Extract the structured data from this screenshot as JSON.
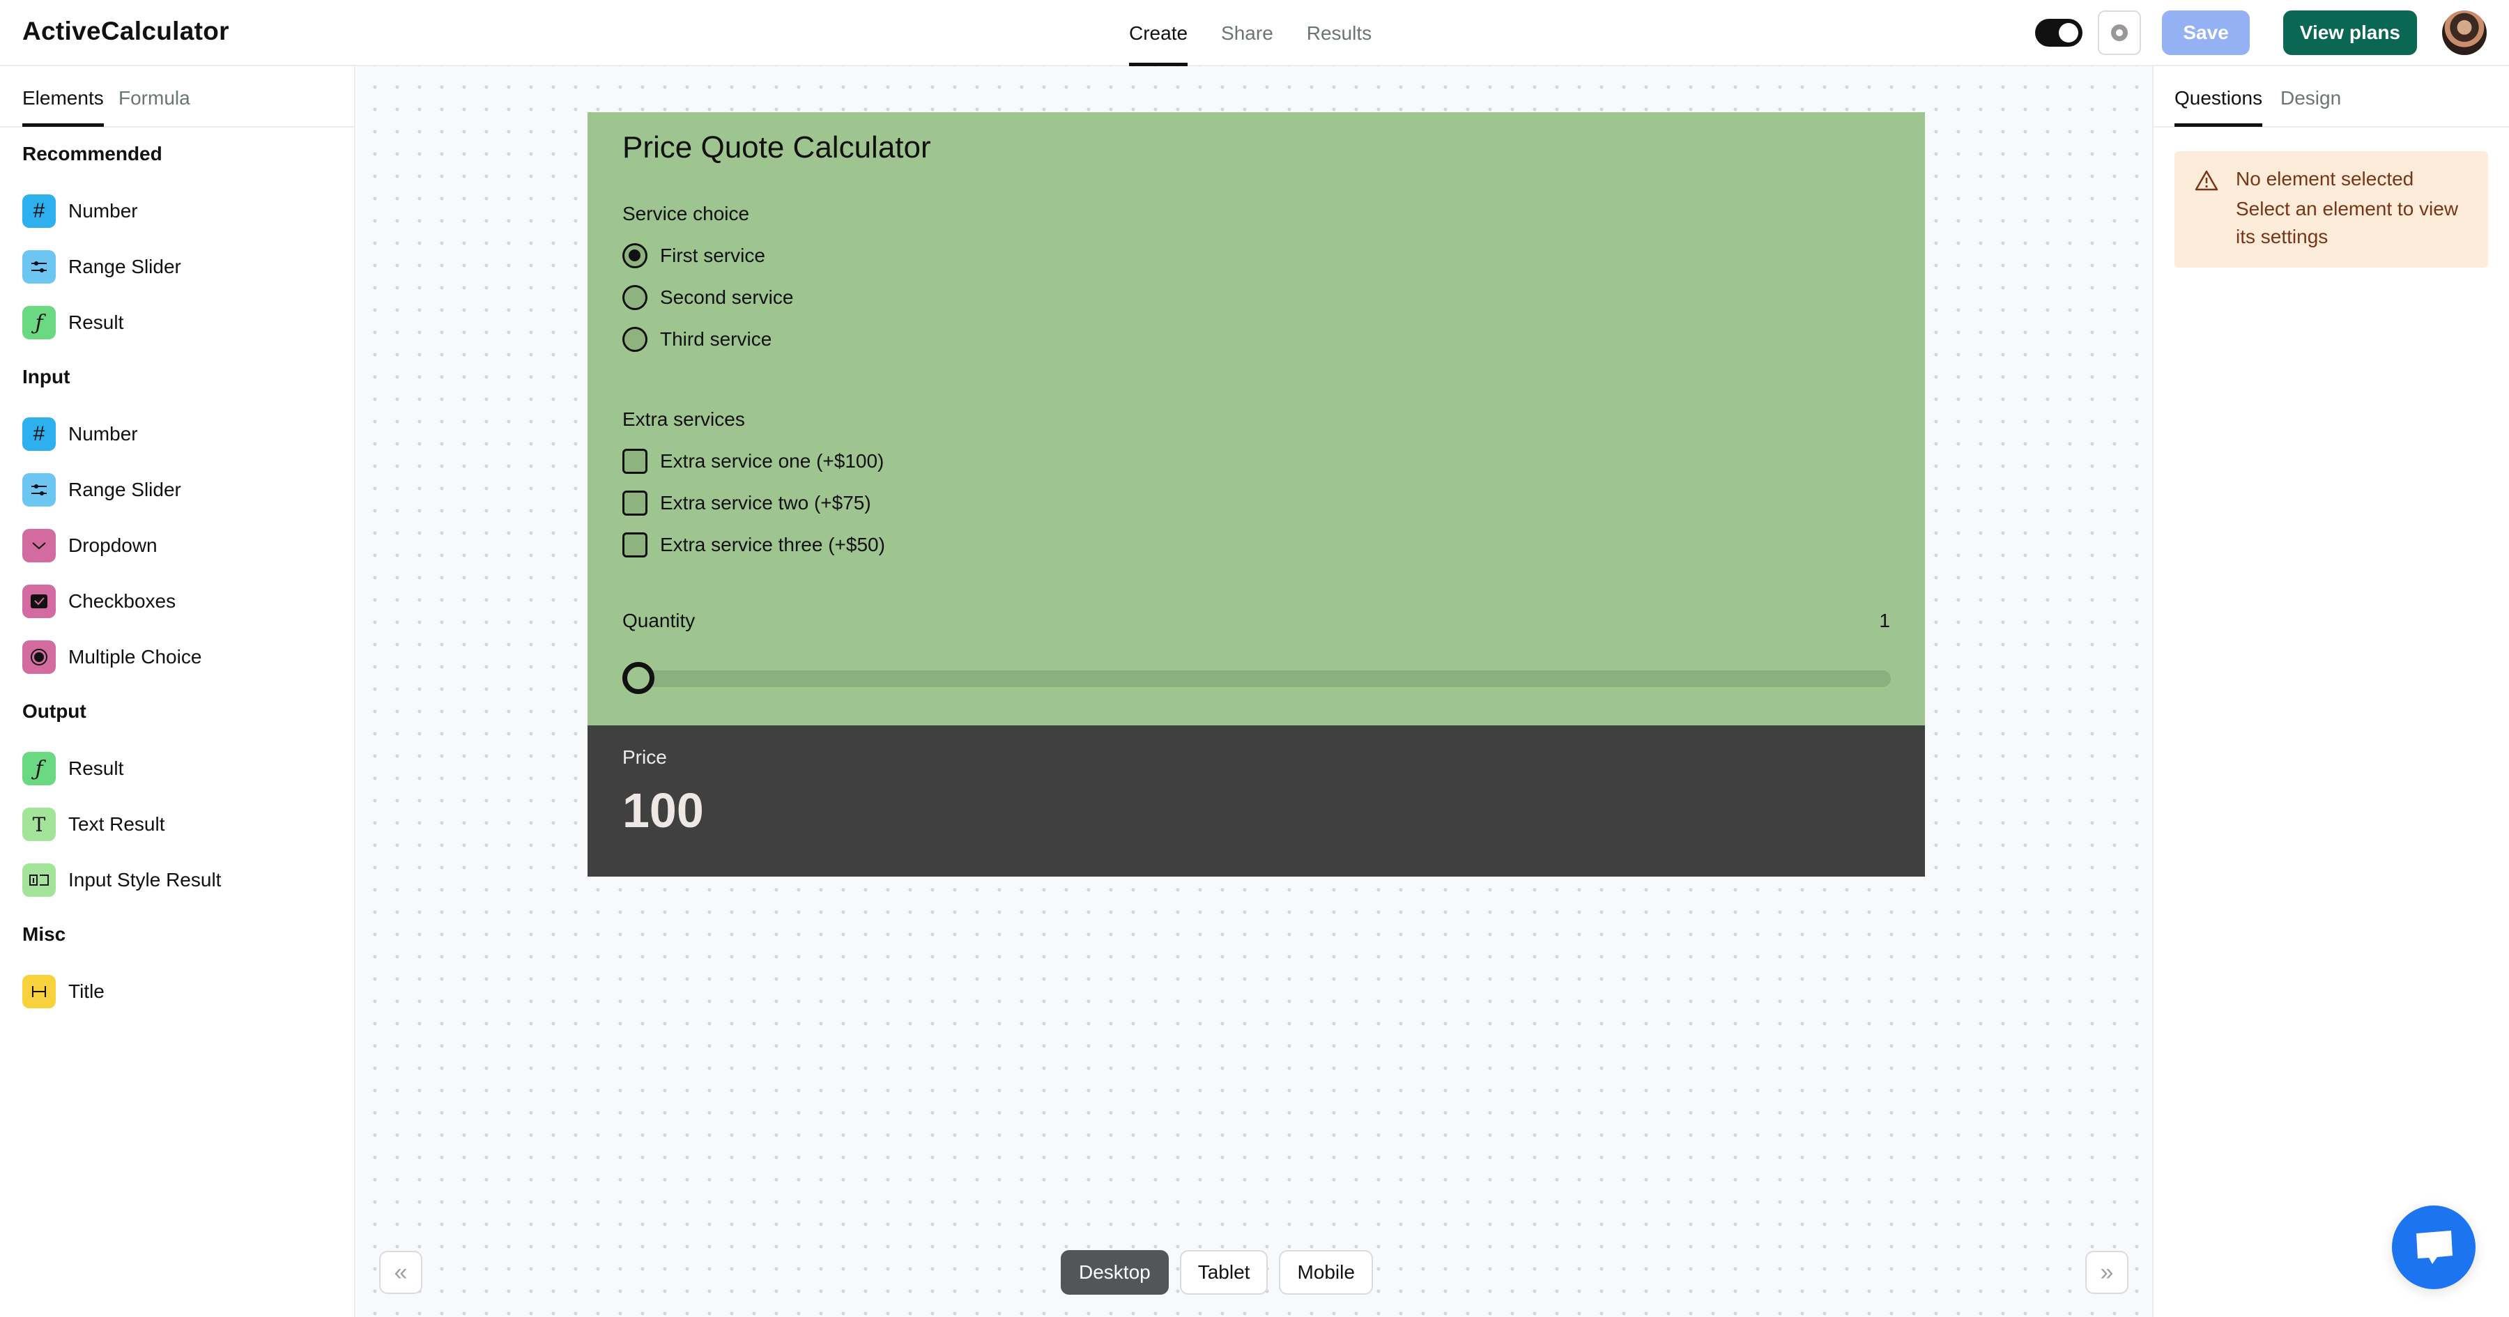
{
  "header": {
    "logo": "ActiveCalculator",
    "nav": [
      {
        "label": "Create",
        "active": true
      },
      {
        "label": "Share",
        "active": false
      },
      {
        "label": "Results",
        "active": false
      }
    ],
    "toggle_state": "on",
    "preview_icon": "eye-icon",
    "save_label": "Save",
    "view_plans_label": "View plans",
    "colors": {
      "save": "#94b1f4",
      "view_plans": "#0a6753"
    }
  },
  "left_panel": {
    "tabs": [
      {
        "label": "Elements",
        "active": true
      },
      {
        "label": "Formula",
        "active": false
      }
    ],
    "sections": [
      {
        "title": "Recommended",
        "items": [
          {
            "label": "Number",
            "icon": "hash-icon",
            "color": "#2fb0ee"
          },
          {
            "label": "Range Slider",
            "icon": "sliders-icon",
            "color": "#6cc6f2"
          },
          {
            "label": "Result",
            "icon": "function-icon",
            "color": "#6bd882"
          }
        ]
      },
      {
        "title": "Input",
        "items": [
          {
            "label": "Number",
            "icon": "hash-icon",
            "color": "#2fb0ee"
          },
          {
            "label": "Range Slider",
            "icon": "sliders-icon",
            "color": "#6cc6f2"
          },
          {
            "label": "Dropdown",
            "icon": "chevron-down-icon",
            "color": "#d46ba0"
          },
          {
            "label": "Checkboxes",
            "icon": "checkbox-icon",
            "color": "#d46ba0"
          },
          {
            "label": "Multiple Choice",
            "icon": "radio-icon",
            "color": "#d46ba0"
          }
        ]
      },
      {
        "title": "Output",
        "items": [
          {
            "label": "Result",
            "icon": "function-icon",
            "color": "#6bd882"
          },
          {
            "label": "Text Result",
            "icon": "text-icon",
            "color": "#a3e39a"
          },
          {
            "label": "Input Style Result",
            "icon": "input-field-icon",
            "color": "#a3e39a"
          }
        ]
      },
      {
        "title": "Misc",
        "items": [
          {
            "label": "Title",
            "icon": "heading-icon",
            "color": "#f8d23c"
          }
        ]
      }
    ]
  },
  "calculator": {
    "title": "Price Quote Calculator",
    "service_choice": {
      "label": "Service choice",
      "options": [
        {
          "label": "First service",
          "selected": true
        },
        {
          "label": "Second service",
          "selected": false
        },
        {
          "label": "Third service",
          "selected": false
        }
      ]
    },
    "extra_services": {
      "label": "Extra services",
      "options": [
        {
          "label": "Extra service one (+$100)",
          "checked": false
        },
        {
          "label": "Extra service two (+$75)",
          "checked": false
        },
        {
          "label": "Extra service three (+$50)",
          "checked": false
        }
      ]
    },
    "quantity": {
      "label": "Quantity",
      "value": "1",
      "fraction": 0
    },
    "price": {
      "label": "Price",
      "value": "100"
    },
    "colors": {
      "form_bg": "#9ec48f",
      "result_bg": "#404040"
    }
  },
  "canvas_controls": {
    "collapse_left_icon": "chevrons-left-icon",
    "collapse_right_icon": "chevrons-right-icon",
    "devices": [
      {
        "label": "Desktop",
        "active": true
      },
      {
        "label": "Tablet",
        "active": false
      },
      {
        "label": "Mobile",
        "active": false
      }
    ]
  },
  "right_panel": {
    "tabs": [
      {
        "label": "Questions",
        "active": true
      },
      {
        "label": "Design",
        "active": false
      }
    ],
    "notice": {
      "icon": "warning-icon",
      "title": "No element selected",
      "text": "Select an element to view its settings"
    }
  },
  "chat_widget": {
    "icon": "chat-bubble-icon",
    "color": "#1d74f0"
  }
}
